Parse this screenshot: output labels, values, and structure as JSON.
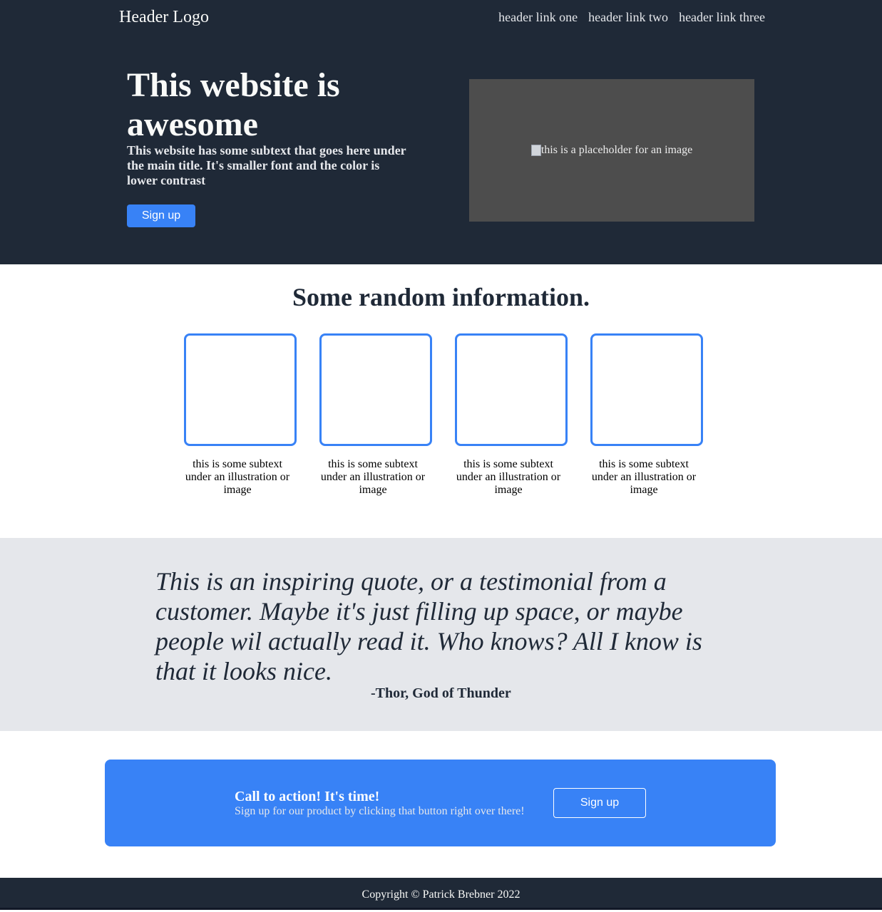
{
  "header": {
    "logo": "Header Logo",
    "links": [
      "header link one",
      "header link two",
      "header link three"
    ]
  },
  "hero": {
    "title": "This website is awesome",
    "subtext": "This website has some subtext that goes here under the main title. It's smaller font and the color is lower contrast",
    "signup_label": "Sign up",
    "image_alt": "this is a placeholder for an image"
  },
  "info": {
    "title": "Some random information.",
    "cards": [
      {
        "caption": "this is some subtext under an illustration or image"
      },
      {
        "caption": "this is some subtext under an illustration or image"
      },
      {
        "caption": "this is some subtext under an illustration or image"
      },
      {
        "caption": "this is some subtext under an illustration or image"
      }
    ]
  },
  "quote": {
    "text": "This is an inspiring quote, or a testimonial from a customer. Maybe it's just filling up space, or maybe people wil actually read it. Who knows? All I know is that it looks nice.",
    "author": "-Thor, God of Thunder"
  },
  "cta": {
    "title": "Call to action! It's time!",
    "subtext": "Sign up for our product by clicking that button right over there!",
    "signup_label": "Sign up"
  },
  "footer": {
    "copyright": "Copyright © Patrick Brebner 2022"
  },
  "colors": {
    "dark": "#1f2937",
    "accent": "#3882f6",
    "light_gray": "#e5e7eb",
    "image_placeholder": "#4d4d4d"
  }
}
